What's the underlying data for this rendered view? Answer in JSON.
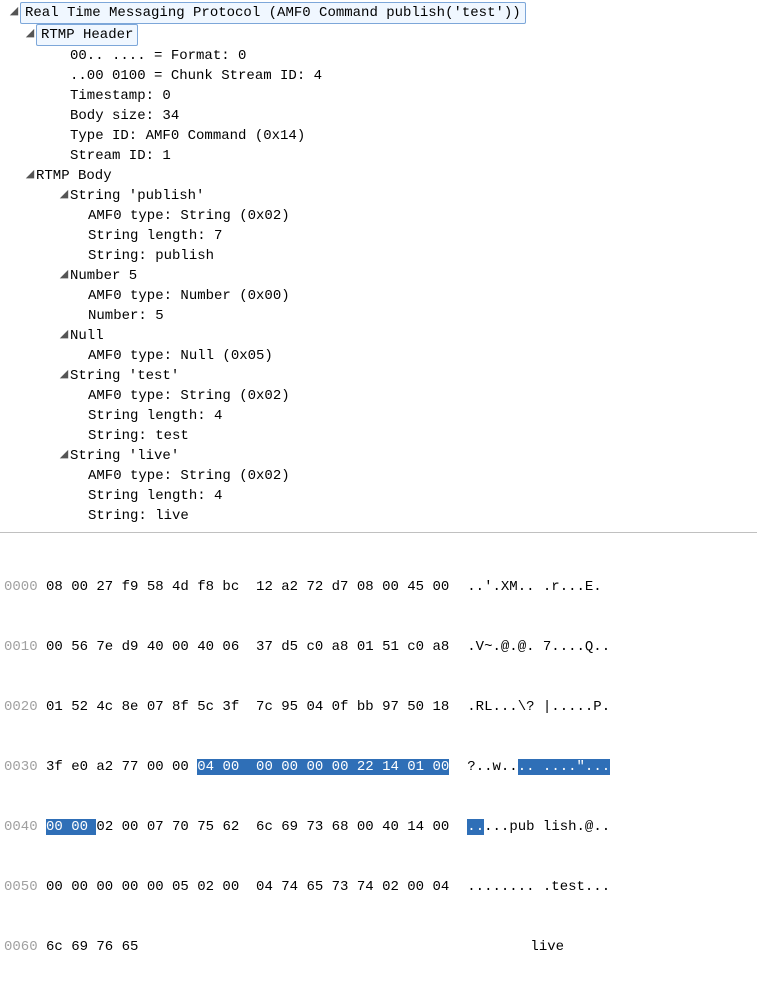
{
  "tree": {
    "root": "Real Time Messaging Protocol (AMF0 Command publish('test'))",
    "header_title": "RTMP Header",
    "header": {
      "format": "00.. .... = Format: 0",
      "csid": "..00 0100 = Chunk Stream ID: 4",
      "ts": "Timestamp: 0",
      "body": "Body size: 34",
      "type": "Type ID: AMF0 Command (0x14)",
      "stream": "Stream ID: 1"
    },
    "body_title": "RTMP Body",
    "body": {
      "s_publish_title": "String 'publish'",
      "s_publish": {
        "type": "AMF0 type: String (0x02)",
        "len": "String length: 7",
        "val": "String: publish"
      },
      "n5_title": "Number 5",
      "n5": {
        "type": "AMF0 type: Number (0x00)",
        "val": "Number: 5"
      },
      "null_title": "Null",
      "null_type": "AMF0 type: Null (0x05)",
      "s_test_title": "String 'test'",
      "s_test": {
        "type": "AMF0 type: String (0x02)",
        "len": "String length: 4",
        "val": "String: test"
      },
      "s_live_title": "String 'live'",
      "s_live": {
        "type": "AMF0 type: String (0x02)",
        "len": "String length: 4",
        "val": "String: live"
      }
    }
  },
  "hex": {
    "rows": [
      {
        "off": "0000",
        "a": "08 00 27 f9 58 4d f8 bc ",
        "b": " 12 a2 72 d7 08 00 45 00",
        "asc": "..'.XM.. .r...E."
      },
      {
        "off": "0010",
        "a": "00 56 7e d9 40 00 40 06 ",
        "b": " 37 d5 c0 a8 01 51 c0 a8",
        "asc": ".V~.@.@. 7....Q.."
      },
      {
        "off": "0020",
        "a": "01 52 4c 8e 07 8f 5c 3f ",
        "b": " 7c 95 04 0f bb 97 50 18",
        "asc": ".RL...\\? |.....P."
      },
      {
        "off": "0030",
        "a": "3f e0 a2 77 00 00 ",
        "h1": "04 00 ",
        "h2": " 00 00 00 00 22 14 01 00",
        "asc_a": "?..w..",
        "asc_h": ".. ....\"...",
        "asc_b": ""
      },
      {
        "off": "0040",
        "h1": "00 00 ",
        "a": "02 00 07 70 75 62 ",
        "b": " 6c 69 73 68 00 40 14 00",
        "asc_h": "..",
        "asc_a": "...pub lish.@..",
        "asc_b": ""
      },
      {
        "off": "0050",
        "a": "00 00 00 00 00 05 02 00 ",
        "b": " 04 74 65 73 74 02 00 04",
        "asc": "........ .test..."
      },
      {
        "off": "0060",
        "a": "6c 69 76 65",
        "b": "",
        "asc": "live"
      }
    ]
  }
}
